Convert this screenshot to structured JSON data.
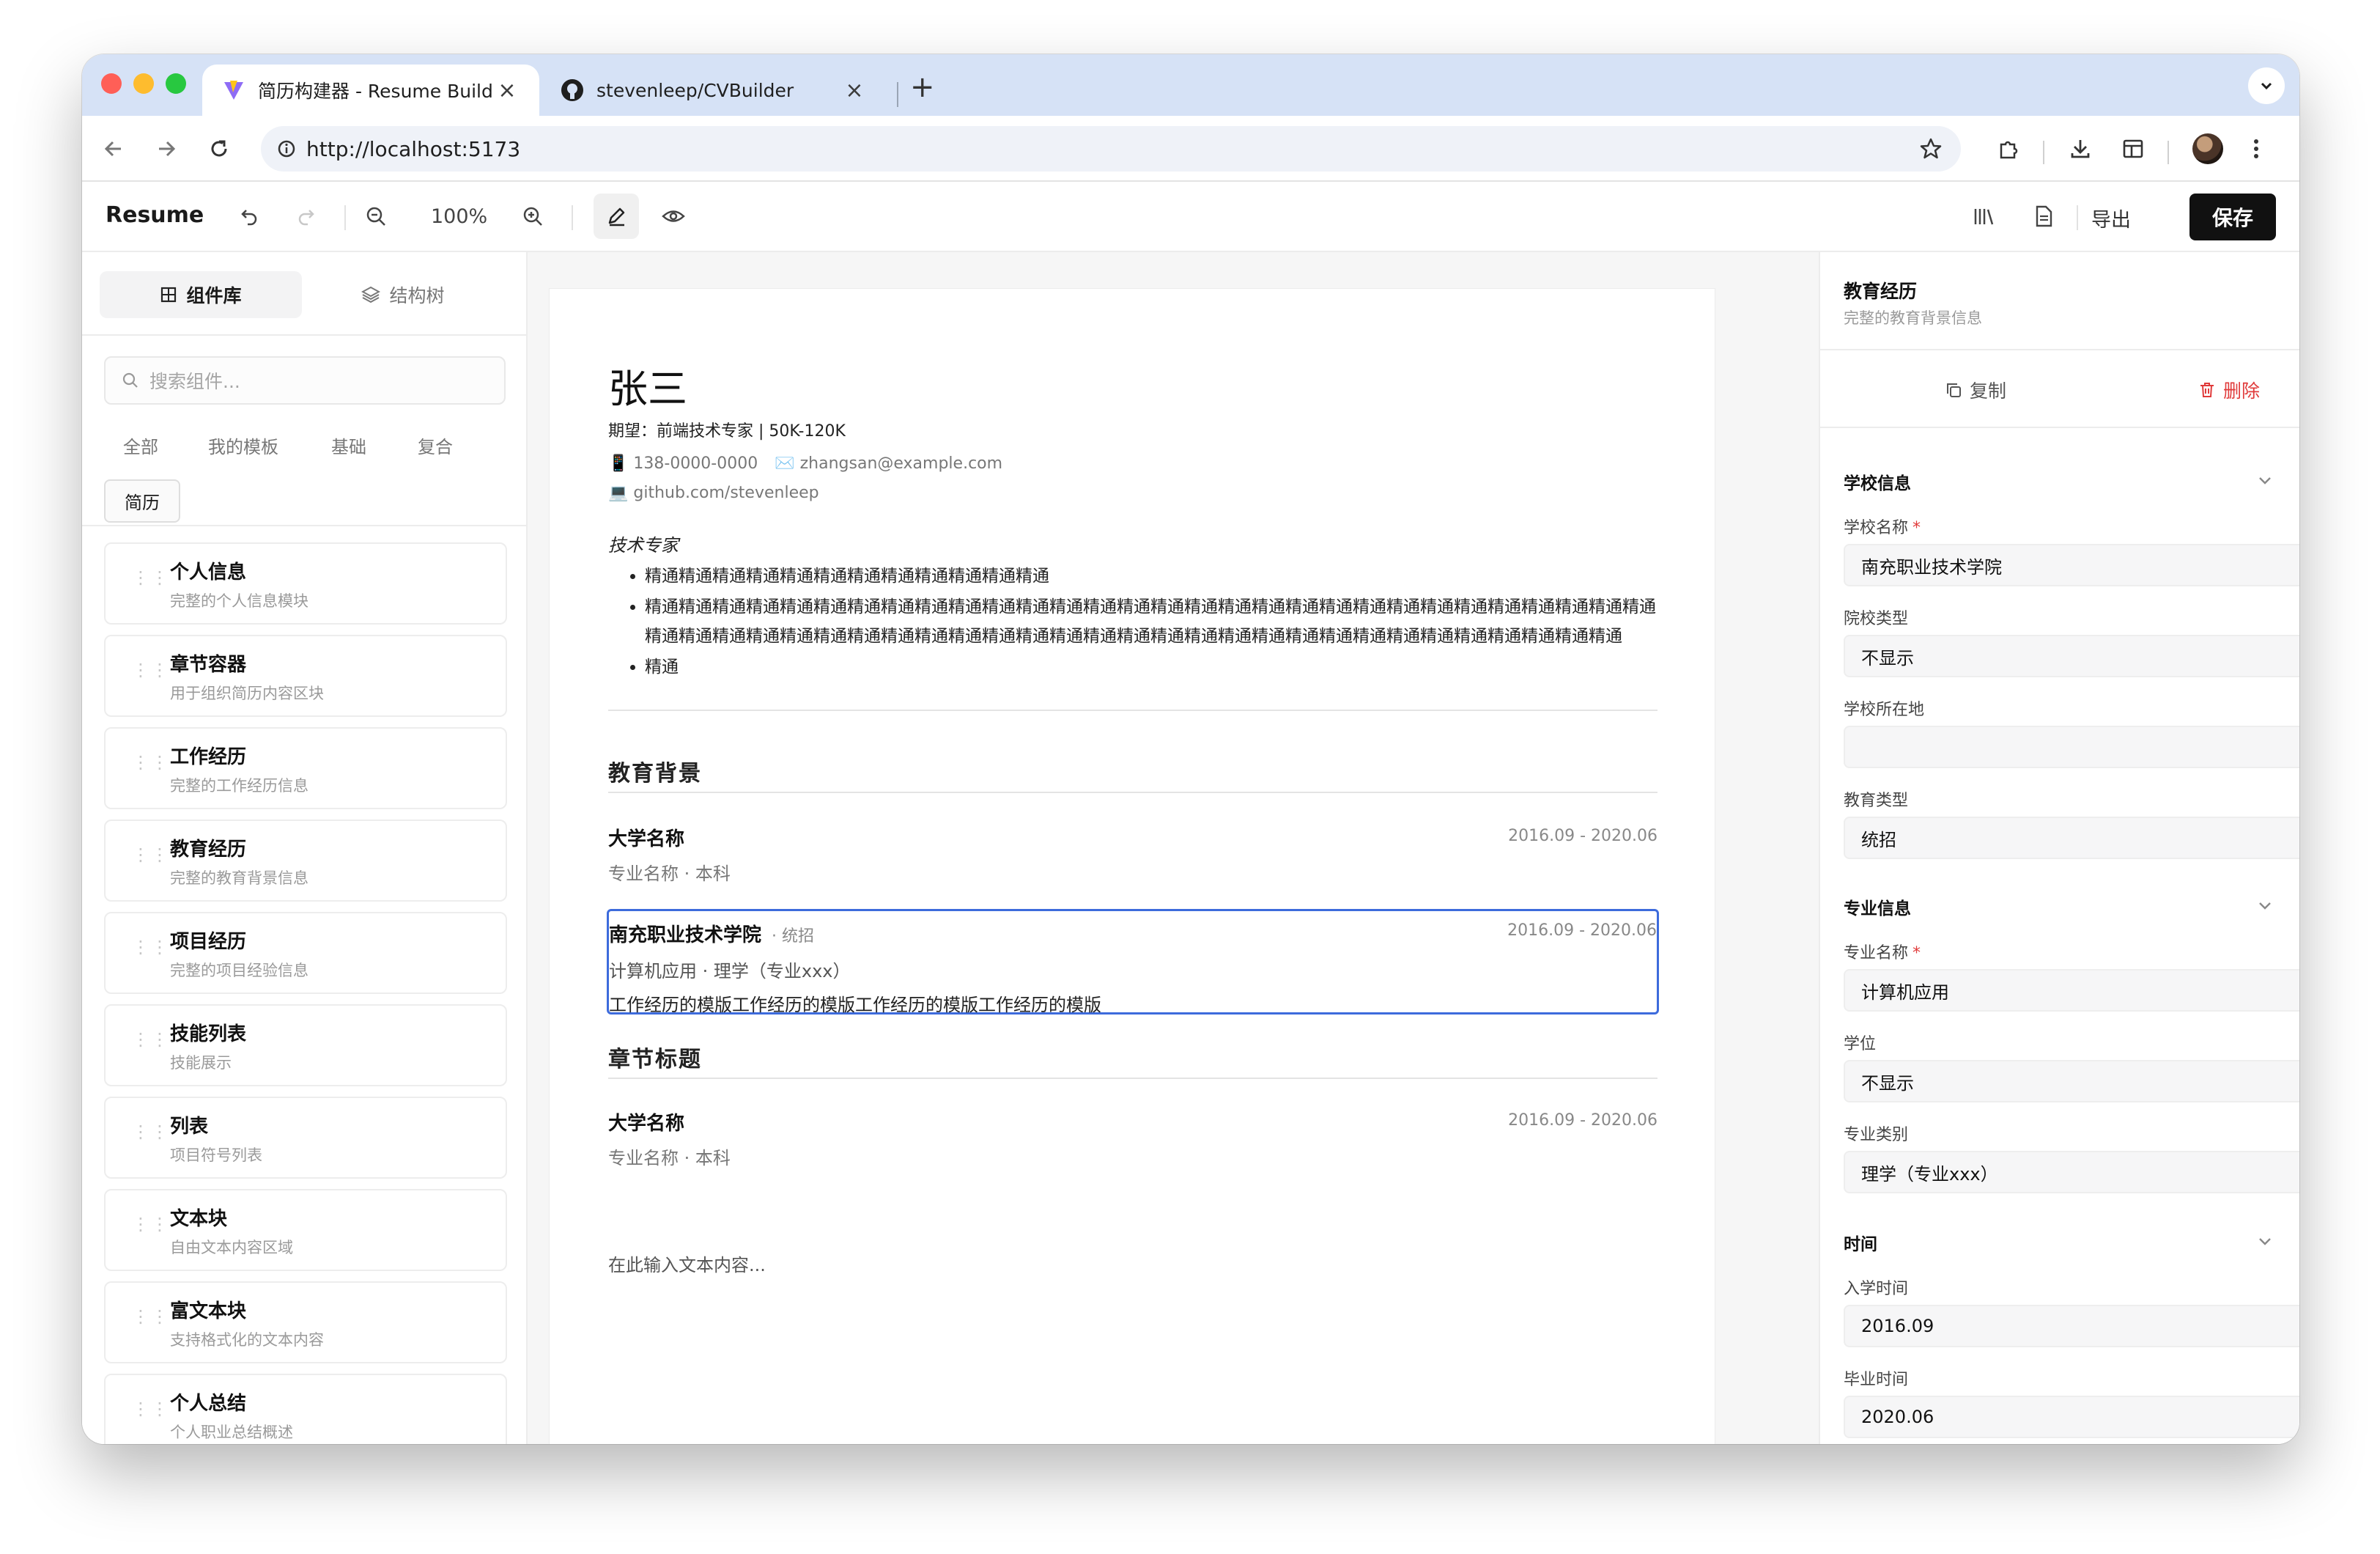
{
  "browser": {
    "tabs": [
      {
        "title": "简历构建器 - Resume Builder",
        "active": true
      },
      {
        "title": "stevenleep/CVBuilder",
        "active": false
      }
    ],
    "url": "http://localhost:5173"
  },
  "toolbar": {
    "brand": "Resume",
    "zoom": "100%",
    "export_label": "导出",
    "save_label": "保存"
  },
  "left_panel": {
    "tabs": [
      "组件库",
      "结构树"
    ],
    "search_placeholder": "搜索组件...",
    "filters": [
      "全部",
      "我的模板",
      "基础",
      "复合",
      "简历"
    ],
    "active_filter": "简历",
    "components": [
      {
        "title": "个人信息",
        "desc": "完整的个人信息模块"
      },
      {
        "title": "章节容器",
        "desc": "用于组织简历内容区块"
      },
      {
        "title": "工作经历",
        "desc": "完整的工作经历信息"
      },
      {
        "title": "教育经历",
        "desc": "完整的教育背景信息"
      },
      {
        "title": "项目经历",
        "desc": "完整的项目经验信息"
      },
      {
        "title": "技能列表",
        "desc": "技能展示"
      },
      {
        "title": "列表",
        "desc": "项目符号列表"
      },
      {
        "title": "文本块",
        "desc": "自由文本内容区域"
      },
      {
        "title": "富文本块",
        "desc": "支持格式化的文本内容"
      },
      {
        "title": "个人总结",
        "desc": "个人职业总结概述"
      }
    ]
  },
  "resume": {
    "name": "张三",
    "expectation": "期望：前端技术专家 | 50K-120K",
    "phone": "📱 138-0000-0000",
    "email": "✉️ zhangsan@example.com",
    "github": "💻 github.com/stevenleep",
    "intro": "技术专家",
    "bullets": [
      "精通精通精通精通精通精通精通精通精通精通精通精通",
      "精通精通精通精通精通精通精通精通精通精通精通精通精通精通精通精通精通精通精通精通精通精通精通精通精通精通精通精通精通精通精通精通精通精通精通精通精通精通精通精通精通精通精通精通精通精通精通精通精通精通精通精通精通精通精通精通精通精通精通",
      "精通"
    ],
    "section1": "教育背景",
    "edu1": {
      "school": "大学名称",
      "date": "2016.09 - 2020.06",
      "sub": "专业名称 · 本科"
    },
    "edu2": {
      "school": "南充职业技术学院",
      "tag": "· 统招",
      "date": "2016.09 - 2020.06",
      "sub": "计算机应用 · 理学（专业xxx）",
      "desc": "工作经历的模版工作经历的模版工作经历的模版工作经历的模版"
    },
    "section2": "章节标题",
    "edu3": {
      "school": "大学名称",
      "date": "2016.09 - 2020.06",
      "sub": "专业名称 · 本科"
    },
    "text_placeholder": "在此输入文本内容..."
  },
  "right_panel": {
    "title": "教育经历",
    "subtitle": "完整的教育背景信息",
    "copy_label": "复制",
    "delete_label": "删除",
    "groups": {
      "school": "学校信息",
      "major": "专业信息",
      "time": "时间"
    },
    "fields": {
      "school_name": {
        "label": "学校名称",
        "value": "南充职业技术学院"
      },
      "school_type": {
        "label": "院校类型",
        "value": "不显示"
      },
      "school_location": {
        "label": "学校所在地",
        "value": ""
      },
      "edu_type": {
        "label": "教育类型",
        "value": "统招"
      },
      "major_name": {
        "label": "专业名称",
        "value": "计算机应用"
      },
      "degree": {
        "label": "学位",
        "value": "不显示"
      },
      "major_category": {
        "label": "专业类别",
        "value": "理学（专业xxx）"
      },
      "start_time": {
        "label": "入学时间",
        "value": "2016.09"
      },
      "end_time": {
        "label": "毕业时间",
        "value": "2020.06"
      }
    },
    "required_mark": "*"
  },
  "colors": {
    "accent": "#3d6bdc",
    "danger": "#e03a3a",
    "tabstrip": "#d6e2f6",
    "save_bg": "#111111"
  }
}
